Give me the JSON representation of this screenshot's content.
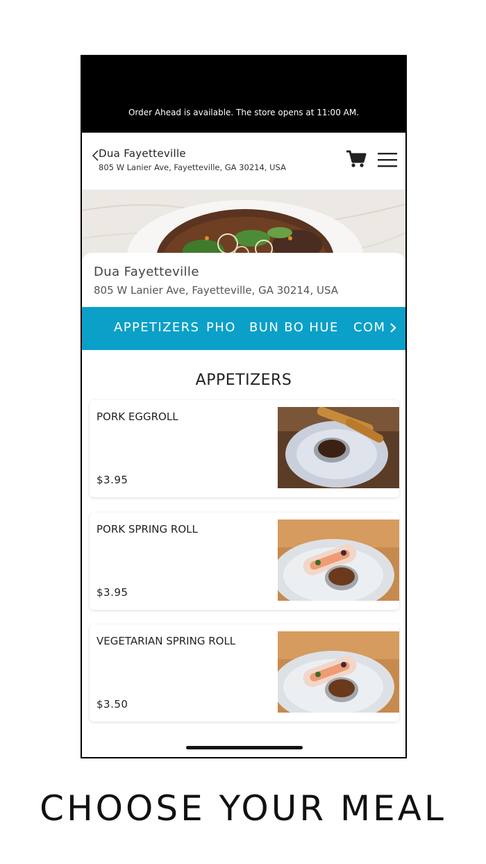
{
  "banner": {
    "text": "Order Ahead is available. The store opens at 11:00 AM."
  },
  "header": {
    "title": "Dua Fayetteville",
    "address": "805 W Lanier Ave, Fayetteville, GA 30214, USA",
    "back_icon": "chevron-left-icon",
    "cart_icon": "cart-icon",
    "menu_icon": "hamburger-menu-icon"
  },
  "store_info": {
    "name": "Dua Fayetteville",
    "address": "805 W Lanier Ave, Fayetteville, GA 30214, USA"
  },
  "categories": {
    "items": [
      "APPETIZERS",
      "PHO",
      "BUN BO HUE",
      "COM"
    ],
    "accent": "#0aa0c8"
  },
  "section": {
    "title": "APPETIZERS"
  },
  "menu_items": [
    {
      "name": "PORK EGGROLL",
      "price": "$3.95"
    },
    {
      "name": "PORK SPRING ROLL",
      "price": "$3.95"
    },
    {
      "name": "VEGETARIAN SPRING ROLL",
      "price": "$3.50"
    }
  ],
  "tagline": "CHOOSE YOUR MEAL"
}
